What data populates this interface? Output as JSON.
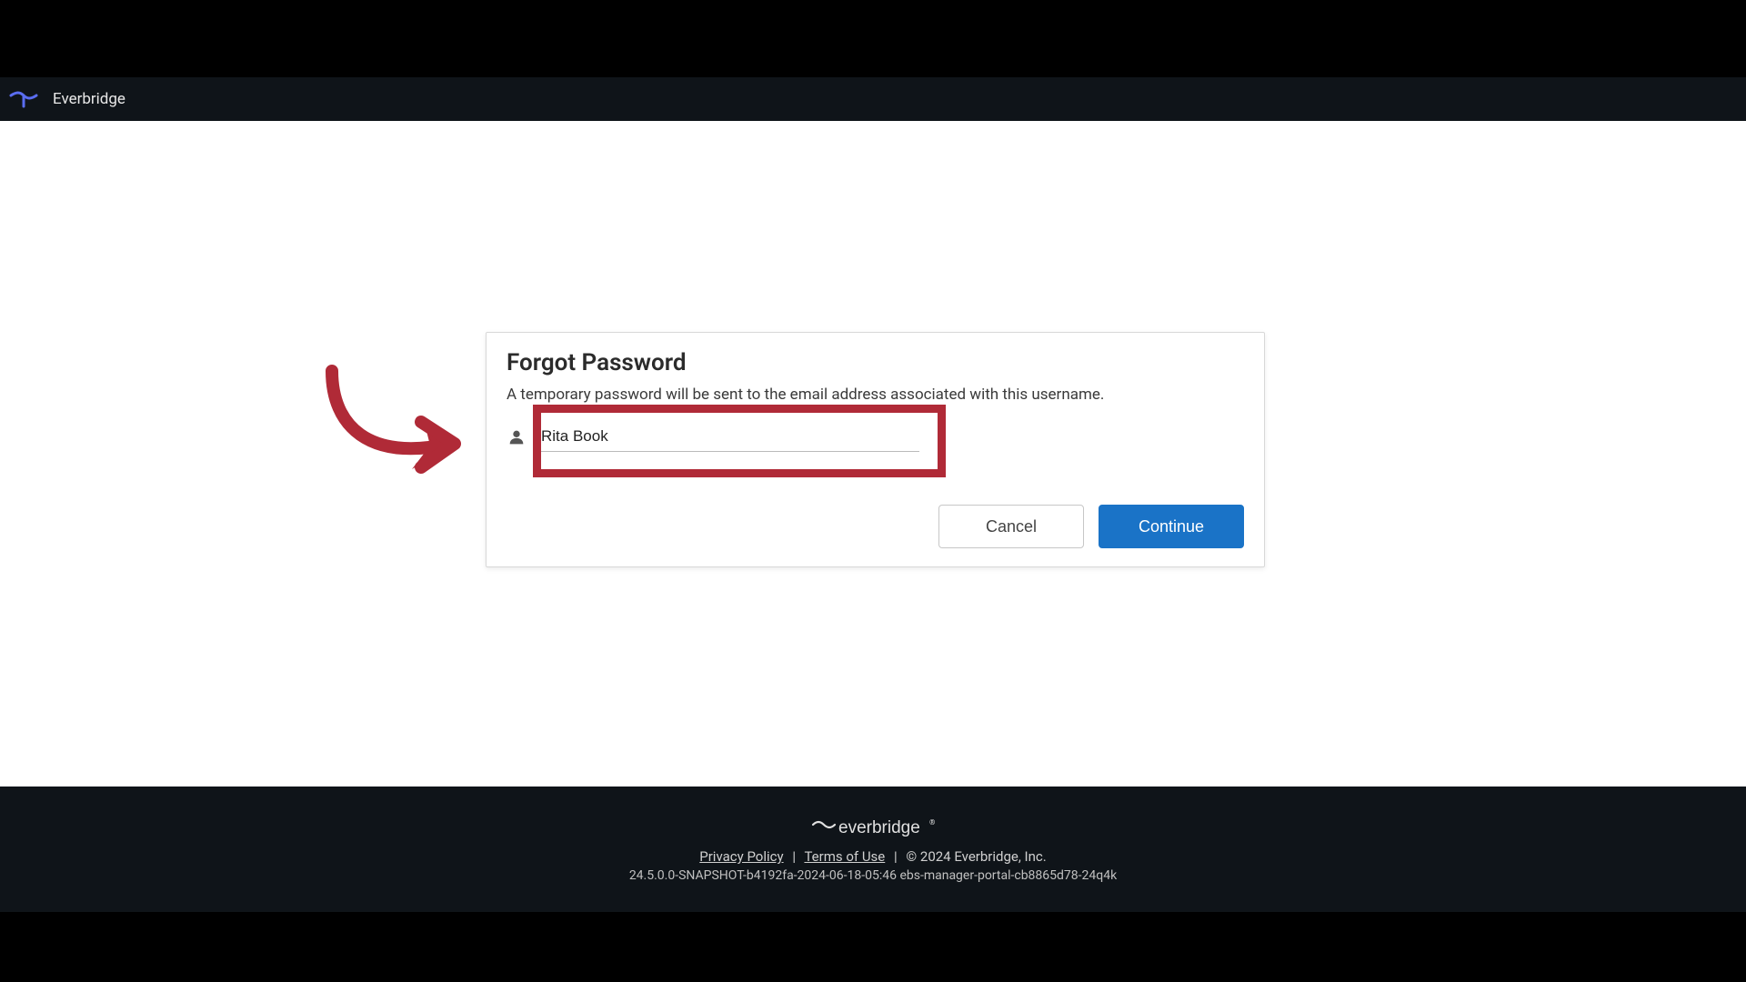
{
  "header": {
    "brand": "Everbridge"
  },
  "dialog": {
    "title": "Forgot Password",
    "subtitle": "A temporary password will be sent to the email address associated with this username.",
    "username_value": "Rita Book",
    "cancel_label": "Cancel",
    "continue_label": "Continue"
  },
  "footer": {
    "logo_text": "everbridge",
    "privacy_label": "Privacy Policy",
    "terms_label": "Terms of Use",
    "copyright": "©  2024 Everbridge, Inc.",
    "build": "24.5.0.0-SNAPSHOT-b4192fa-2024-06-18-05:46 ebs-manager-portal-cb8865d78-24q4k"
  },
  "annotation": {
    "arrow_color": "#b02a37",
    "highlight_color": "#b02a37"
  }
}
